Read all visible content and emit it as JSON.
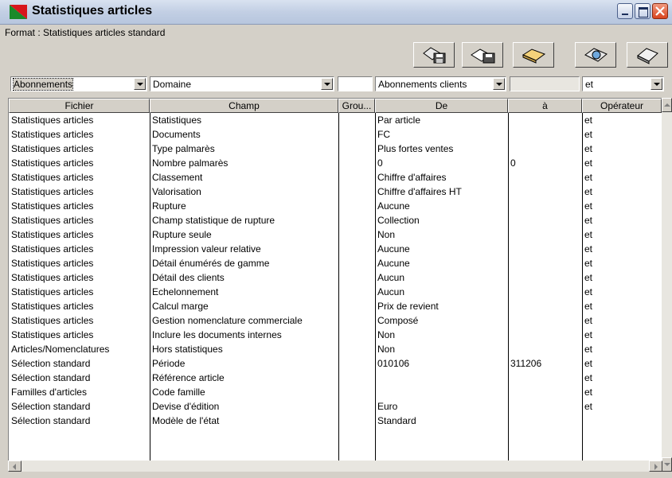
{
  "window": {
    "title": "Statistiques articles",
    "accent": "#c2cfe4"
  },
  "format_label": "Format : Statistiques articles standard",
  "toolbar_icons": [
    "save-icon",
    "save-as-icon",
    "open-folder-icon",
    "print-preview-icon",
    "print-icon"
  ],
  "filters": {
    "file_combo": "Abonnements",
    "field_combo": "Domaine",
    "from_combo": "Abonnements clients",
    "operator_combo": "et"
  },
  "columns": [
    "Fichier",
    "Champ",
    "Grou...",
    "De",
    "à",
    "Opérateur"
  ],
  "rows": [
    [
      "Statistiques articles",
      "Statistiques",
      "",
      "Par article",
      "",
      "et"
    ],
    [
      "Statistiques articles",
      "Documents",
      "",
      "FC",
      "",
      "et"
    ],
    [
      "Statistiques articles",
      "Type palmarès",
      "",
      "Plus fortes ventes",
      "",
      "et"
    ],
    [
      "Statistiques articles",
      "Nombre palmarès",
      "",
      "0",
      "0",
      "et"
    ],
    [
      "Statistiques articles",
      "Classement",
      "",
      "Chiffre d'affaires",
      "",
      "et"
    ],
    [
      "Statistiques articles",
      "Valorisation",
      "",
      "Chiffre d'affaires HT",
      "",
      "et"
    ],
    [
      "Statistiques articles",
      "Rupture",
      "",
      "Aucune",
      "",
      "et"
    ],
    [
      "Statistiques articles",
      "Champ statistique de rupture",
      "",
      "Collection",
      "",
      "et"
    ],
    [
      "Statistiques articles",
      "Rupture seule",
      "",
      "Non",
      "",
      "et"
    ],
    [
      "Statistiques articles",
      "Impression valeur relative",
      "",
      "Aucune",
      "",
      "et"
    ],
    [
      "Statistiques articles",
      "Détail énumérés de gamme",
      "",
      "Aucune",
      "",
      "et"
    ],
    [
      "Statistiques articles",
      "Détail des clients",
      "",
      "Aucun",
      "",
      "et"
    ],
    [
      "Statistiques articles",
      "Echelonnement",
      "",
      "Aucun",
      "",
      "et"
    ],
    [
      "Statistiques articles",
      "Calcul marge",
      "",
      "Prix de revient",
      "",
      "et"
    ],
    [
      "Statistiques articles",
      "Gestion nomenclature commerciale",
      "",
      "Composé",
      "",
      "et"
    ],
    [
      "Statistiques articles",
      "Inclure les documents internes",
      "",
      "Non",
      "",
      "et"
    ],
    [
      "Articles/Nomenclatures",
      "Hors statistiques",
      "",
      "Non",
      "",
      "et"
    ],
    [
      "Sélection standard",
      "Période",
      "",
      "010106",
      "311206",
      "et"
    ],
    [
      "Sélection standard",
      "Référence article",
      "",
      "",
      "",
      "et"
    ],
    [
      "Familles d'articles",
      "Code famille",
      "",
      "",
      "",
      "et"
    ],
    [
      "Sélection standard",
      "Devise d'édition",
      "",
      "Euro",
      "",
      "et"
    ],
    [
      "Sélection standard",
      "Modèle de l'état",
      "",
      "Standard",
      "",
      ""
    ]
  ]
}
